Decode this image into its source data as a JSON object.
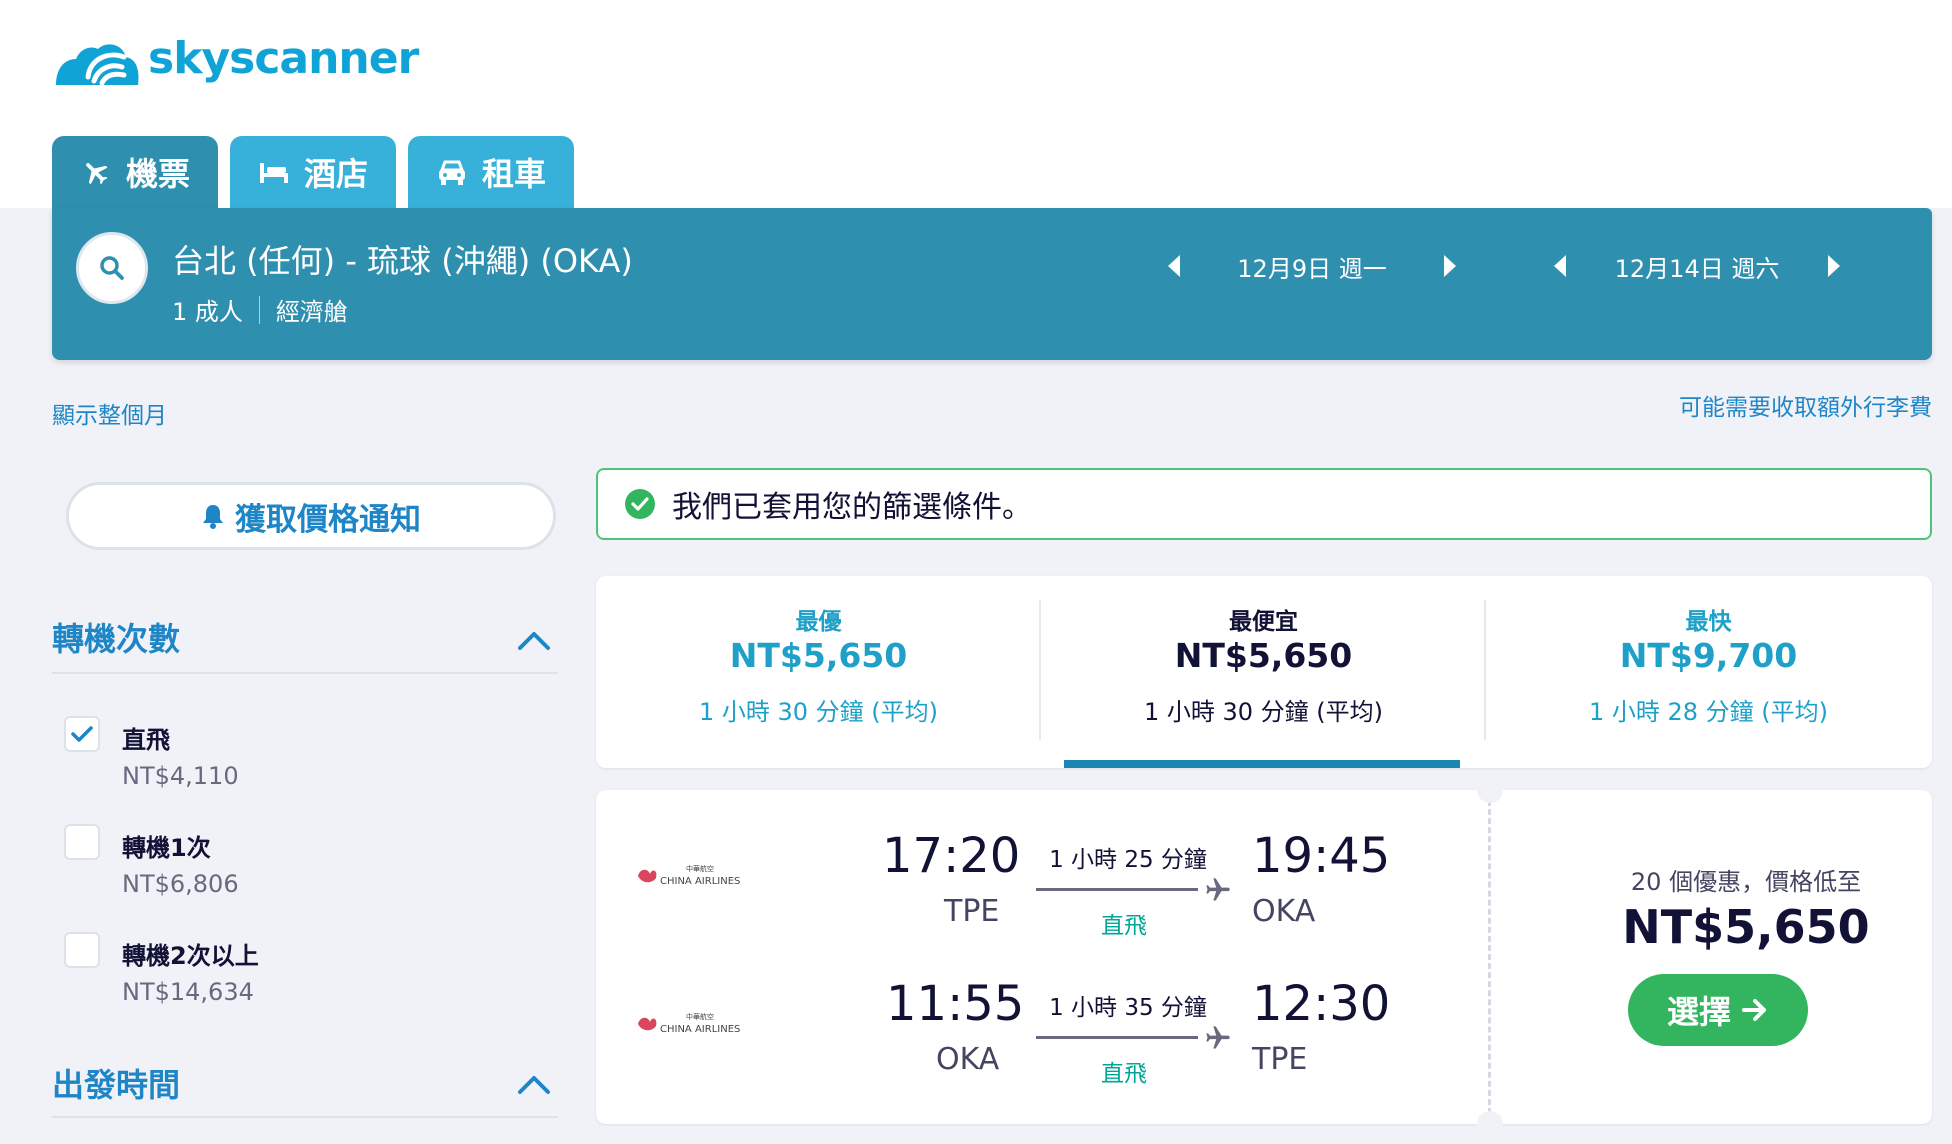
{
  "brand": {
    "name": "skyscanner"
  },
  "tabs": [
    {
      "label": "機票",
      "icon": "plane-icon",
      "active": true
    },
    {
      "label": "酒店",
      "icon": "bed-icon",
      "active": false
    },
    {
      "label": "租車",
      "icon": "car-icon",
      "active": false
    }
  ],
  "search": {
    "route": "台北 (任何) - 琉球 (沖繩) (OKA)",
    "travellers": "1 成人",
    "cabin": "經濟艙",
    "depart_date": "12月9日 週一",
    "return_date": "12月14日 週六"
  },
  "links": {
    "whole_month": "顯示整個月",
    "baggage_fees": "可能需要收取額外行李費"
  },
  "price_alert": {
    "label": "獲取價格通知"
  },
  "filters": {
    "stops": {
      "title": "轉機次數",
      "options": [
        {
          "label": "直飛",
          "price": "NT$4,110",
          "checked": true
        },
        {
          "label": "轉機1次",
          "price": "NT$6,806",
          "checked": false
        },
        {
          "label": "轉機2次以上",
          "price": "NT$14,634",
          "checked": false
        }
      ]
    },
    "departure": {
      "title": "出發時間"
    }
  },
  "banner": {
    "text": "我們已套用您的篩選條件。"
  },
  "sort": [
    {
      "label": "最優",
      "price": "NT$5,650",
      "duration": "1 小時 30 分鐘 (平均)"
    },
    {
      "label": "最便宜",
      "price": "NT$5,650",
      "duration": "1 小時 30 分鐘 (平均)",
      "selected": true
    },
    {
      "label": "最快",
      "price": "NT$9,700",
      "duration": "1 小時 28 分鐘 (平均)"
    }
  ],
  "result": {
    "legs": [
      {
        "airline": "CHINA AIRLINES",
        "dep_time": "17:20",
        "dep_code": "TPE",
        "duration": "1 小時 25 分鐘",
        "stops": "直飛",
        "arr_time": "19:45",
        "arr_code": "OKA"
      },
      {
        "airline": "CHINA AIRLINES",
        "dep_time": "11:55",
        "dep_code": "OKA",
        "duration": "1 小時 35 分鐘",
        "stops": "直飛",
        "arr_time": "12:30",
        "arr_code": "TPE"
      }
    ],
    "deals": "20 個優惠，價格低至",
    "price": "NT$5,650",
    "select_label": "選擇"
  },
  "colors": {
    "brand": "#0fa3d6",
    "search_bar": "#2f8fae",
    "link": "#1e86c7",
    "success": "#32b55e"
  }
}
